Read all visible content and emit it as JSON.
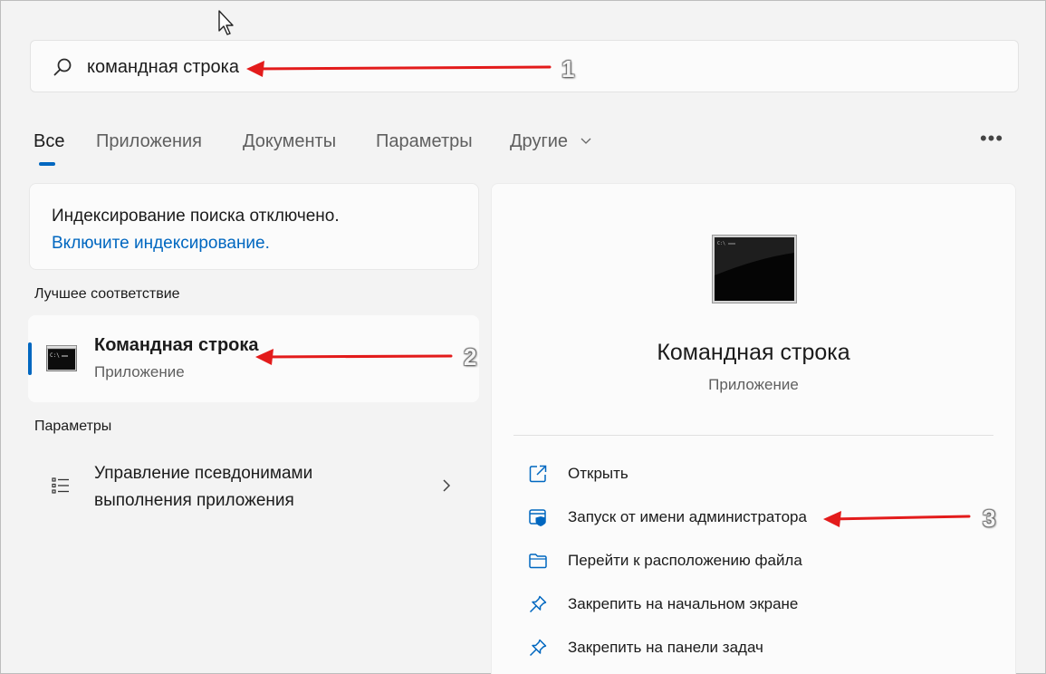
{
  "search": {
    "value": "командная строка"
  },
  "tabs": [
    {
      "label": "Все"
    },
    {
      "label": "Приложения"
    },
    {
      "label": "Документы"
    },
    {
      "label": "Параметры"
    },
    {
      "label": "Другие"
    }
  ],
  "more_label": "•••",
  "index_notice": {
    "text": "Индексирование поиска отключено.",
    "link": "Включите индексирование."
  },
  "best_match": {
    "section_title": "Лучшее соответствие",
    "title": "Командная строка",
    "subtitle": "Приложение"
  },
  "settings": {
    "section_title": "Параметры",
    "item_line1": "Управление псевдонимами",
    "item_line2": "выполнения приложения"
  },
  "detail": {
    "title": "Командная строка",
    "subtitle": "Приложение",
    "actions": [
      {
        "label": "Открыть",
        "icon": "open-icon"
      },
      {
        "label": "Запуск от имени администратора",
        "icon": "shield-icon"
      },
      {
        "label": "Перейти к расположению файла",
        "icon": "folder-icon"
      },
      {
        "label": "Закрепить на начальном экране",
        "icon": "pin-icon"
      },
      {
        "label": "Закрепить на панели задач",
        "icon": "pin-icon"
      }
    ]
  },
  "annotations": [
    "1",
    "2",
    "3"
  ],
  "colors": {
    "accent": "#0067c0",
    "arrow": "#e31b1b",
    "background": "#f3f3f3"
  }
}
